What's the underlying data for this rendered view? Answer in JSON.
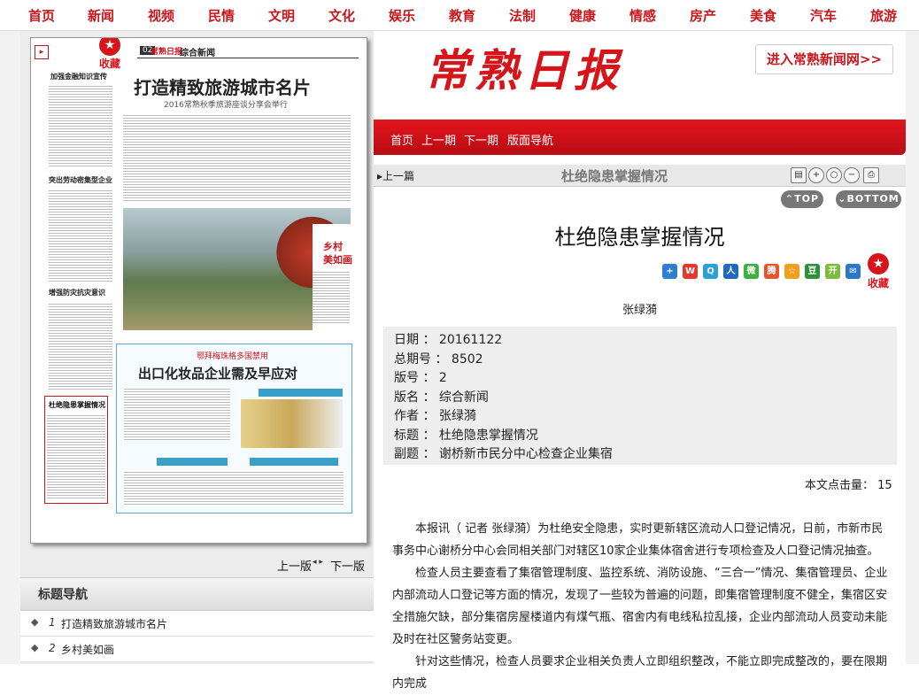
{
  "topnav": [
    "首页",
    "新闻",
    "视频",
    "民情",
    "文明",
    "文化",
    "娱乐",
    "教育",
    "法制",
    "健康",
    "情感",
    "房产",
    "美食",
    "汽车",
    "旅游"
  ],
  "header": {
    "logo": "常熟日报",
    "site_button": "进入常熟新闻网>>"
  },
  "subnav": [
    "首页",
    "上一期",
    "下一期",
    "版面导航"
  ],
  "paper": {
    "masthead": "常熟日报",
    "section_no": "02",
    "section_name": "综合新闻",
    "headline": "打造精致旅游城市名片",
    "subheadline": "2016常熟秋季旅游座谈分享会举行",
    "left_titles": [
      "加强金融知识宣传",
      "突出劳动密集型企业",
      "增强防灾抗灾意识",
      "杜绝隐患掌握情况"
    ],
    "rural": [
      "乡村",
      "美如画"
    ],
    "box_head": "出口化妆品企业需及早应对",
    "box_sub": "鄂拜梅珠格多国禁用",
    "fav_label": "收藏"
  },
  "pager": {
    "prev": "上一版",
    "next": "下一版"
  },
  "title_nav": {
    "heading": "标题导航",
    "items": [
      {
        "num": "1",
        "text": "打造精致旅游城市名片"
      },
      {
        "num": "2",
        "text": "乡村美如画"
      }
    ]
  },
  "toolbar": {
    "prev": "上一篇",
    "title": "杜绝隐患掌握情况"
  },
  "pills": {
    "top": "TOP",
    "bottom": "BOTTOM"
  },
  "article": {
    "title": "杜绝隐患掌握情况",
    "author": "张绿漪",
    "fav_label": "收藏",
    "meta": [
      {
        "k": "日期",
        "v": "20161122"
      },
      {
        "k": "总期号",
        "v": "8502"
      },
      {
        "k": "版号",
        "v": "2"
      },
      {
        "k": "版名",
        "v": "综合新闻"
      },
      {
        "k": "作者",
        "v": "张绿漪"
      },
      {
        "k": "标题",
        "v": "杜绝隐患掌握情况"
      },
      {
        "k": "副题",
        "v": "谢桥新市民分中心检查企业集宿"
      }
    ],
    "hits_label": "本文点击量：",
    "hits": "15",
    "paragraphs": [
      "本报讯（ 记者 张绿漪）为杜绝安全隐患，实时更新辖区流动人口登记情况，日前，市新市民事务中心谢桥分中心会同相关部门对辖区10家企业集体宿舍进行专项检查及人口登记情况抽查。",
      "检查人员主要查看了集宿管理制度、监控系统、消防设施、“三合一”情况、集宿管理员、企业内部流动人口登记等方面的情况，发现了一些较为普遍的问题，即集宿管理制度不健全，集宿区安全措施欠缺，部分集宿房屋楼道内有煤气瓶、宿舍内有电线私拉乱接，企业内部流动人员变动未能及时在社区警务站变更。",
      "针对这些情况，检查人员要求企业相关负责人立即组织整改，不能立即完成整改的，要在限期内完成"
    ]
  },
  "colors": {
    "brand_red": "#d7141a",
    "nav_red": "#c8161d"
  }
}
